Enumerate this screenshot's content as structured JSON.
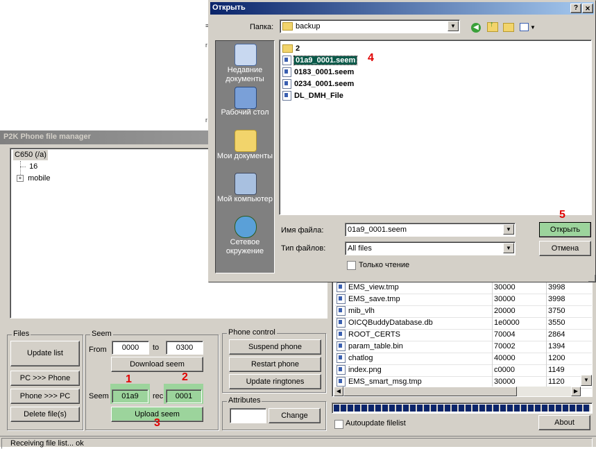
{
  "main_window": {
    "title": "P2K Phone file manager",
    "tree": [
      {
        "label": "C650 (/a)",
        "selected": true
      },
      {
        "label": "16"
      },
      {
        "label": "mobile",
        "expand": "+"
      }
    ],
    "files_group": {
      "label": "Files",
      "update_list": "Update list",
      "pc_to_phone": "PC >>> Phone",
      "phone_to_pc": "Phone >>> PC",
      "delete_files": "Delete file(s)"
    },
    "seem_group": {
      "label": "Seem",
      "from_label": "From",
      "from_value": "0000",
      "to_label": "to",
      "to_value": "0300",
      "download_seem": "Download seem",
      "seem_label": "Seem",
      "seem_value": "01a9",
      "rec_label": "rec",
      "rec_value": "0001",
      "upload_seem": "Upload seem"
    },
    "phone_control_group": {
      "label": "Phone control",
      "suspend": "Suspend phone",
      "restart": "Restart phone",
      "update_ringtones": "Update ringtones"
    },
    "attributes_group": {
      "label": "Attributes",
      "value": "",
      "change": "Change"
    },
    "file_list": [
      {
        "name": "EMS_view.tmp",
        "id": "30000",
        "size": "3998"
      },
      {
        "name": "EMS_save.tmp",
        "id": "30000",
        "size": "3998"
      },
      {
        "name": "mib_vlh",
        "id": "20000",
        "size": "3750"
      },
      {
        "name": "OICQBuddyDatabase.db",
        "id": "1e0000",
        "size": "3550"
      },
      {
        "name": "ROOT_CERTS",
        "id": "70004",
        "size": "2864"
      },
      {
        "name": "param_table.bin",
        "id": "70002",
        "size": "1394"
      },
      {
        "name": "chatlog",
        "id": "40000",
        "size": "1200"
      },
      {
        "name": "index.png",
        "id": "c0000",
        "size": "1149"
      },
      {
        "name": "EMS_smart_msg.tmp",
        "id": "30000",
        "size": "1120"
      }
    ],
    "progress_fraction": 1.0,
    "autoupdate_label": "Autoupdate filelist",
    "about": "About",
    "status": "Receiving file list... ok"
  },
  "open_dialog": {
    "title": "Открыть",
    "help_button": "?",
    "close_button": "×",
    "folder_label": "Папка:",
    "folder_value": "backup",
    "places": [
      {
        "label": "Недавние документы",
        "icon": "recent-documents-icon"
      },
      {
        "label": "Рабочий стол",
        "icon": "desktop-icon"
      },
      {
        "label": "Мои документы",
        "icon": "my-documents-icon"
      },
      {
        "label": "Мой компьютер",
        "icon": "my-computer-icon"
      },
      {
        "label": "Сетевое окружение",
        "icon": "network-icon"
      }
    ],
    "items": [
      {
        "name": "2",
        "type": "folder"
      },
      {
        "name": "01a9_0001.seem",
        "type": "file",
        "selected": true
      },
      {
        "name": "0183_0001.seem",
        "type": "file"
      },
      {
        "name": "0234_0001.seem",
        "type": "file"
      },
      {
        "name": "DL_DMH_File",
        "type": "file"
      }
    ],
    "filename_label": "Имя файла:",
    "filename_value": "01a9_0001.seem",
    "filetype_label": "Тип файлов:",
    "filetype_value": "All files",
    "readonly_label": "Только чтение",
    "open_button": "Открыть",
    "cancel_button": "Отмена"
  },
  "annotations": [
    "1",
    "2",
    "3",
    "4",
    "5"
  ],
  "colors": {
    "dialog_title": "#0a246a",
    "highlight_green": "#9cd49c",
    "selection": "#0a5a4a",
    "annotation": "#e00000",
    "places_bar": "#808080"
  }
}
